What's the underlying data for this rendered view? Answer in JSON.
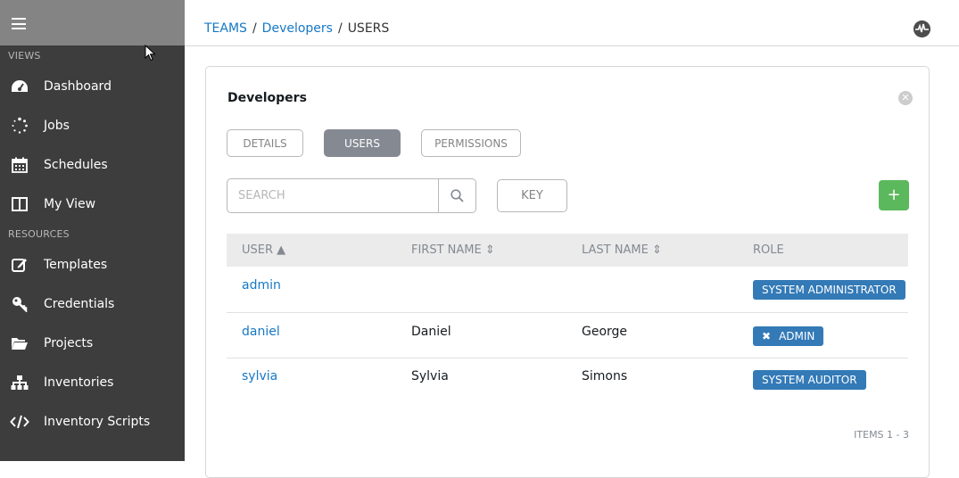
{
  "sidebar": {
    "views_label": "VIEWS",
    "views": [
      {
        "label": "Dashboard",
        "icon": "dashboard-icon"
      },
      {
        "label": "Jobs",
        "icon": "jobs-icon"
      },
      {
        "label": "Schedules",
        "icon": "calendar-icon"
      },
      {
        "label": "My View",
        "icon": "columns-icon"
      }
    ],
    "resources_label": "RESOURCES",
    "resources": [
      {
        "label": "Templates",
        "icon": "edit-icon"
      },
      {
        "label": "Credentials",
        "icon": "key-icon"
      },
      {
        "label": "Projects",
        "icon": "folder-icon"
      },
      {
        "label": "Inventories",
        "icon": "sitemap-icon"
      },
      {
        "label": "Inventory Scripts",
        "icon": "code-icon"
      }
    ]
  },
  "breadcrumb": {
    "teams": "TEAMS",
    "team": "Developers",
    "current": "USERS",
    "sep": "/"
  },
  "panel": {
    "title": "Developers",
    "tabs": {
      "details": "DETAILS",
      "users": "USERS",
      "permissions": "PERMISSIONS"
    },
    "search_placeholder": "SEARCH",
    "key_label": "KEY",
    "add_label": "+",
    "columns": {
      "user": "USER",
      "first": "FIRST NAME",
      "last": "LAST NAME",
      "role": "ROLE"
    },
    "rows": [
      {
        "user": "admin",
        "first": "",
        "last": "",
        "role": "SYSTEM ADMINISTRATOR"
      },
      {
        "user": "daniel",
        "first": "Daniel",
        "last": "George",
        "role": "ADMIN"
      },
      {
        "user": "sylvia",
        "first": "Sylvia",
        "last": "Simons",
        "role": "SYSTEM AUDITOR"
      }
    ],
    "items_count": "ITEMS  1 - 3"
  },
  "colors": {
    "sidebar_bg": "#3d3d3d",
    "link": "#1678c4",
    "badge": "#337ab7",
    "add": "#5cb85c",
    "active_tab": "#848992"
  }
}
